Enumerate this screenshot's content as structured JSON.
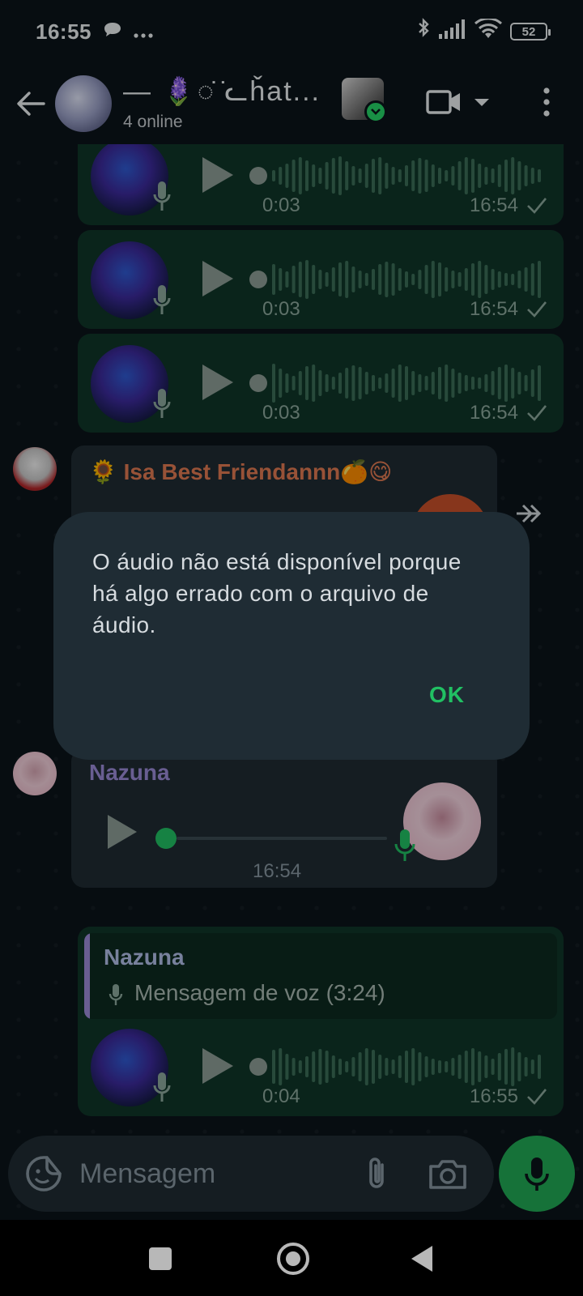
{
  "status_bar": {
    "time": "16:55",
    "battery": "52"
  },
  "header": {
    "title": "— 🪻◌̇ ̇ᓚȟat...",
    "subtitle": "4 online"
  },
  "voice_messages_top": [
    {
      "duration": "0:03",
      "time": "16:54"
    },
    {
      "duration": "0:03",
      "time": "16:54"
    },
    {
      "duration": "0:03",
      "time": "16:54"
    }
  ],
  "incoming_1": {
    "sender": "🌻 Isa Best Friendannn🍊😋"
  },
  "dialog": {
    "message": "O áudio não está disponível porque há algo errado com o arquivo de áudio.",
    "ok_label": "OK"
  },
  "incoming_2": {
    "sender": "Nazuna",
    "time": "16:54"
  },
  "reply_message": {
    "quoted_sender": "Nazuna",
    "quoted_text": "Mensagem de voz (3:24)",
    "duration": "0:04",
    "time": "16:55"
  },
  "composer": {
    "placeholder": "Mensagem"
  },
  "colors": {
    "outgoing_bubble": "#103629",
    "incoming_bubble": "#1f2c33",
    "accent_green": "#21c063",
    "sender_isa": "#e07a52",
    "sender_nazuna": "#9b8bd8"
  }
}
